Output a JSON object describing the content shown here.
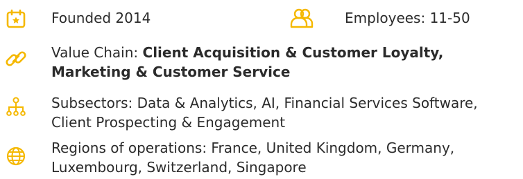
{
  "colors": {
    "accent": "#F5B800",
    "text": "#2B2B2B"
  },
  "founded": {
    "icon": "calendar-icon",
    "text": "Founded 2014"
  },
  "employees": {
    "icon": "people-icon",
    "text": "Employees: 11-50"
  },
  "value_chain": {
    "icon": "link-icon",
    "label": "Value Chain: ",
    "value_line1": "Client Acquisition & Customer Loyalty,",
    "value_line2": "Marketing & Customer Service"
  },
  "subsectors": {
    "icon": "hierarchy-icon",
    "line1": "Subsectors: Data & Analytics, AI, Financial Services Software,",
    "line2": "Client Prospecting & Engagement"
  },
  "regions": {
    "icon": "globe-icon",
    "line1": "Regions of operations: France, United Kingdom, Germany,",
    "line2": "Luxembourg, Switzerland, Singapore"
  }
}
